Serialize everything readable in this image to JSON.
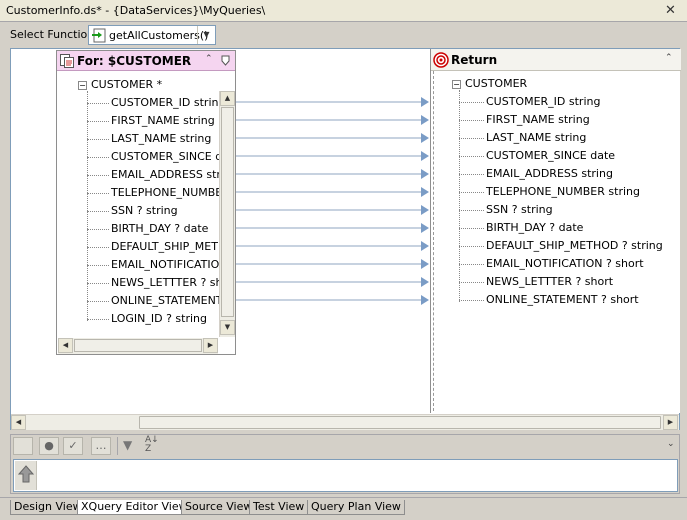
{
  "window": {
    "title": "CustomerInfo.ds* - {DataServices}\\MyQueries\\"
  },
  "function_bar": {
    "label": "Select Function:",
    "value": "getAllCustomers()"
  },
  "source_panel": {
    "title": "For: $CUSTOMER",
    "root": "CUSTOMER *",
    "fields": [
      "CUSTOMER_ID  string",
      "FIRST_NAME  string",
      "LAST_NAME  string",
      "CUSTOMER_SINCE  date",
      "EMAIL_ADDRESS  string",
      "TELEPHONE_NUMBER  string",
      "SSN ?  string",
      "BIRTH_DAY ?  date",
      "DEFAULT_SHIP_METHOD ?  string",
      "EMAIL_NOTIFICATION ?  short",
      "NEWS_LETTTER ?  short",
      "ONLINE_STATEMENT ?  short",
      "LOGIN_ID ?  string"
    ]
  },
  "return_panel": {
    "title": "Return",
    "root": "CUSTOMER",
    "fields": [
      "CUSTOMER_ID  string",
      "FIRST_NAME  string",
      "LAST_NAME  string",
      "CUSTOMER_SINCE  date",
      "EMAIL_ADDRESS  string",
      "TELEPHONE_NUMBER  string",
      "SSN ?  string",
      "BIRTH_DAY ?  date",
      "DEFAULT_SHIP_METHOD ?  string",
      "EMAIL_NOTIFICATION ?  short",
      "NEWS_LETTTER ?  short",
      "ONLINE_STATEMENT ?  short"
    ]
  },
  "tabs": [
    "Design View",
    "XQuery Editor View",
    "Source View",
    "Test View",
    "Query Plan View"
  ],
  "active_tab": "XQuery Editor View",
  "colors": {
    "source_header": "#f5d5f0",
    "mapping_line": "#8fa4c0",
    "arrow": "#7a9cc6"
  },
  "icons": {
    "function": "green-arrow-function-icon",
    "source": "for-clause-icon",
    "return": "target-return-icon",
    "collapse": "double-chevron-up-icon"
  }
}
